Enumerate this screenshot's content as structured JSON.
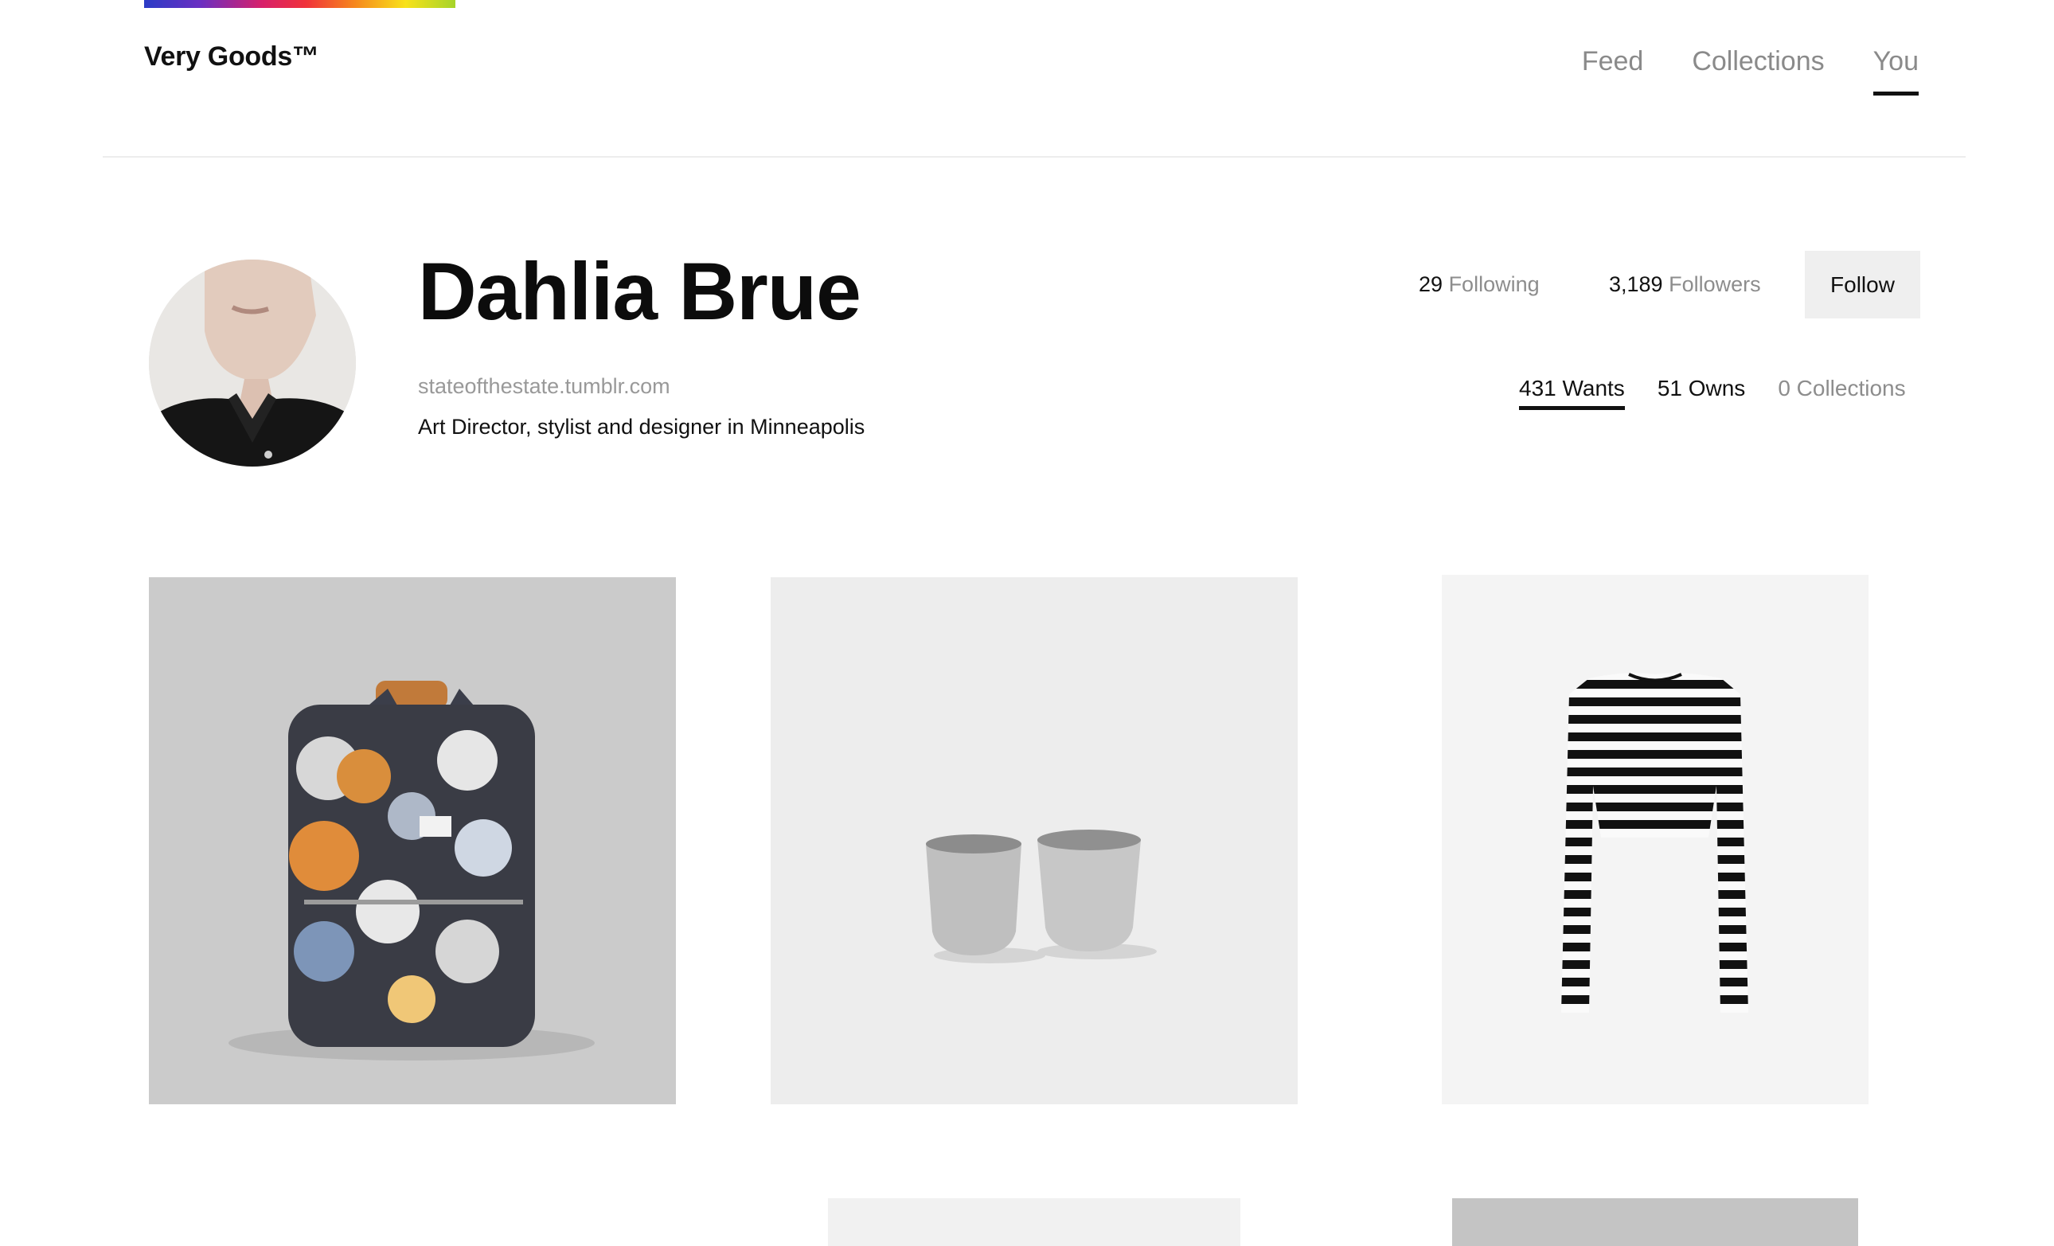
{
  "header": {
    "logo": "Very Goods™",
    "nav": [
      {
        "label": "Feed",
        "active": false
      },
      {
        "label": "Collections",
        "active": false
      },
      {
        "label": "You",
        "active": true
      }
    ]
  },
  "profile": {
    "name": "Dahlia Brue",
    "website": "stateofthestate.tumblr.com",
    "bio": "Art Director, stylist and designer in Minneapolis",
    "following": {
      "count": "29",
      "label": "Following"
    },
    "followers": {
      "count": "3,189",
      "label": "Followers"
    },
    "follow_button": "Follow",
    "tabs": [
      {
        "label": "431 Wants",
        "active": true
      },
      {
        "label": "51 Owns",
        "active": false
      },
      {
        "label": "0 Collections",
        "active": false
      }
    ]
  },
  "products": [
    {
      "icon": "floral-backpack-image"
    },
    {
      "icon": "metal-cups-image"
    },
    {
      "icon": "striped-shirt-image"
    },
    {
      "icon": "product-image"
    },
    {
      "icon": "product-image"
    },
    {
      "icon": "product-image"
    }
  ],
  "colors": {
    "accent_gradient": [
      "#2b3cc6",
      "#d8206a",
      "#f6891d",
      "#f8e21a",
      "#a6d42a"
    ],
    "text": "#111111",
    "muted": "#8d8d8d",
    "button_bg": "#efefef"
  }
}
